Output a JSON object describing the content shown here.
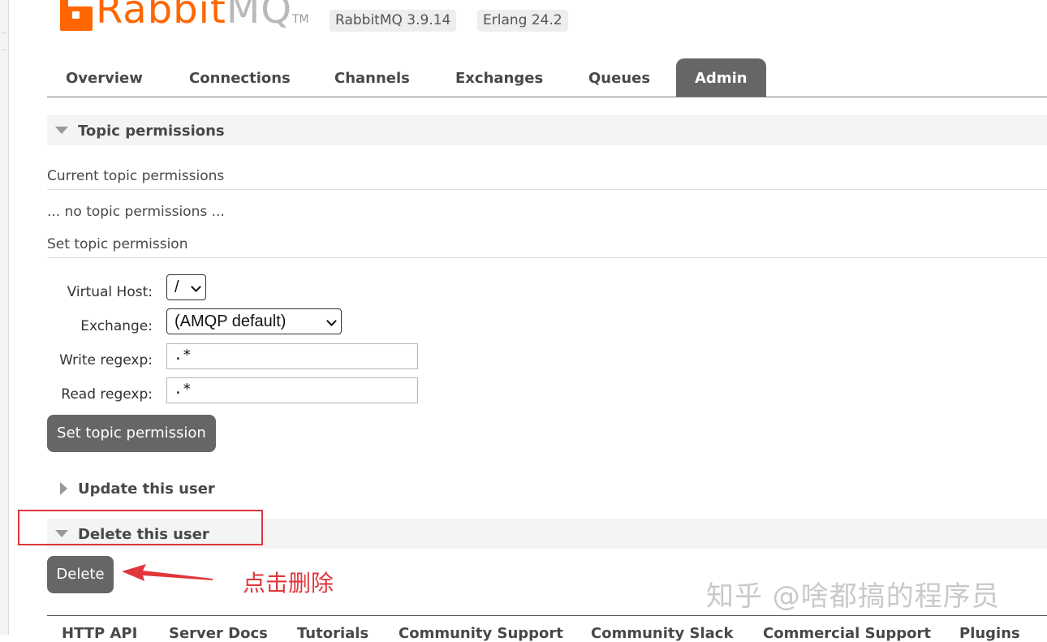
{
  "header": {
    "logo_text_primary": "Rabbit",
    "logo_text_secondary": "MQ",
    "trademark": "TM",
    "rabbitmq_version": "RabbitMQ 3.9.14",
    "erlang_version": "Erlang 24.2"
  },
  "nav": {
    "tabs": [
      {
        "label": "Overview",
        "active": false
      },
      {
        "label": "Connections",
        "active": false
      },
      {
        "label": "Channels",
        "active": false
      },
      {
        "label": "Exchanges",
        "active": false
      },
      {
        "label": "Queues",
        "active": false
      },
      {
        "label": "Admin",
        "active": true
      }
    ]
  },
  "topic_permissions": {
    "section_title": "Topic permissions",
    "current_heading": "Current topic permissions",
    "empty_text": "... no topic permissions ...",
    "set_heading": "Set topic permission",
    "form": {
      "virtual_host_label": "Virtual Host:",
      "virtual_host_value": "/",
      "exchange_label": "Exchange:",
      "exchange_value": "(AMQP default)",
      "write_label": "Write regexp:",
      "write_value": ".*",
      "read_label": "Read regexp:",
      "read_value": ".*",
      "submit_label": "Set topic permission"
    }
  },
  "update_user": {
    "section_title": "Update this user"
  },
  "delete_user": {
    "section_title": "Delete this user",
    "button_label": "Delete"
  },
  "annotation": {
    "text": "点击删除",
    "color": "#e0363b"
  },
  "watermark": {
    "text": "知乎 @啥都搞的程序员"
  },
  "footer": {
    "links": [
      "HTTP API",
      "Server Docs",
      "Tutorials",
      "Community Support",
      "Community Slack",
      "Commercial Support",
      "Plugins"
    ]
  },
  "colors": {
    "brand_orange": "#ff6600",
    "tab_active_bg": "#666666",
    "button_bg": "#666666",
    "section_bar_bg": "#f4f4f4"
  }
}
